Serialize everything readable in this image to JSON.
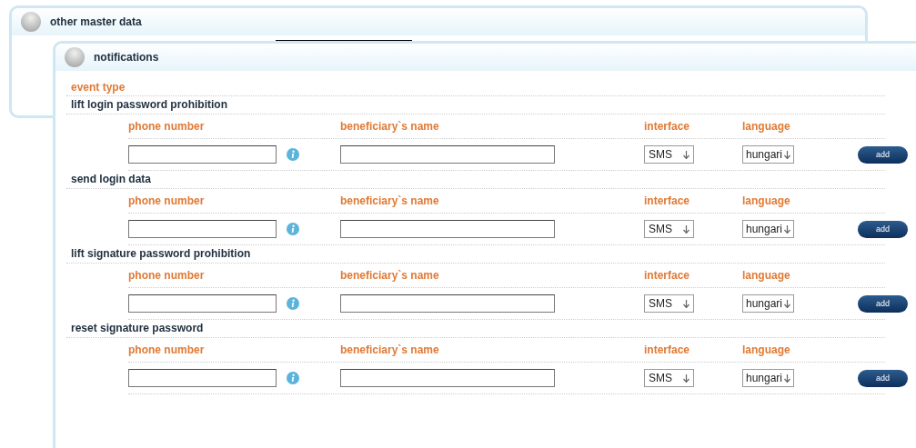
{
  "outer_panel": {
    "title": "other master data"
  },
  "notifications": {
    "title": "notifications",
    "event_type_label": "event type",
    "events": [
      {
        "name": "lift login password prohibition",
        "columns": [
          "phone number",
          "beneficiary`s name",
          "interface",
          "language"
        ],
        "interface": "SMS",
        "language": "hungari",
        "button": "add"
      },
      {
        "name": "send login data",
        "columns": [
          "phone number",
          "beneficiary`s name",
          "interface",
          "language"
        ],
        "interface": "SMS",
        "language": "hungari",
        "button": "add"
      },
      {
        "name": "lift signature password prohibition",
        "columns": [
          "phone number",
          "beneficiary`s name",
          "interface",
          "language"
        ],
        "interface": "SMS",
        "language": "hungari",
        "button": "add"
      },
      {
        "name": "reset signature password",
        "columns": [
          "phone number",
          "beneficiary`s name",
          "interface",
          "language"
        ],
        "interface": "SMS",
        "language": "hungari",
        "button": "add"
      }
    ]
  }
}
